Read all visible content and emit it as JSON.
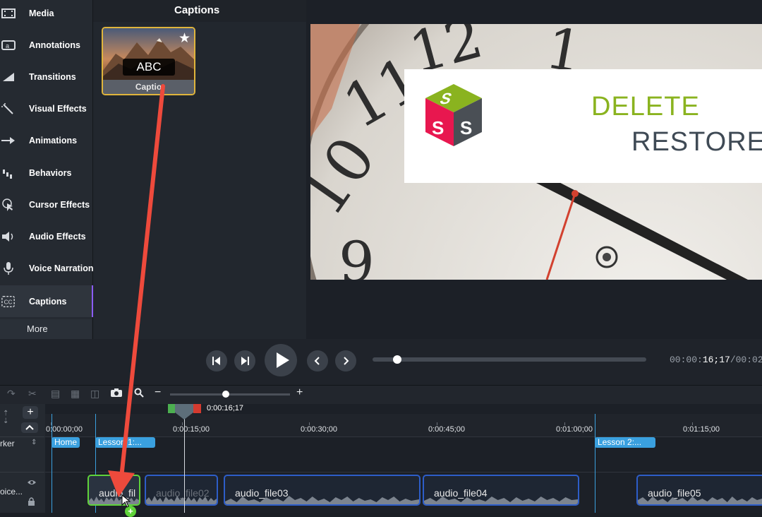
{
  "sidebar": {
    "items": [
      {
        "label": "Media",
        "icon": "film-icon"
      },
      {
        "label": "Annotations",
        "icon": "annotation-icon"
      },
      {
        "label": "Transitions",
        "icon": "transition-icon"
      },
      {
        "label": "Visual Effects",
        "icon": "magic-wand-icon"
      },
      {
        "label": "Animations",
        "icon": "arrow-animation-icon"
      },
      {
        "label": "Behaviors",
        "icon": "behaviors-icon"
      },
      {
        "label": "Cursor Effects",
        "icon": "cursor-icon"
      },
      {
        "label": "Audio Effects",
        "icon": "speaker-icon"
      },
      {
        "label": "Voice Narration",
        "icon": "microphone-icon"
      },
      {
        "label": "Captions",
        "icon": "cc-icon",
        "active": true
      }
    ],
    "more_label": "More"
  },
  "captions_panel": {
    "title": "Captions",
    "asset": {
      "label": "Captio",
      "overlay_text": "ABC"
    }
  },
  "preview": {
    "logo_text_1": "DELETE",
    "logo_text_2": "RESTORE"
  },
  "playback": {
    "timecode_dim": "00:00:",
    "timecode_bright": "16;17",
    "timecode_tail": "/00:02",
    "progress": 0.09
  },
  "timeline": {
    "playhead_time": "0:00:16;17",
    "ruler_labels": [
      "0:00:00;00",
      "0:00:15;00",
      "0:00:30;00",
      "0:00:45;00",
      "0:01:00;00",
      "0:01:15;00"
    ],
    "track_label_marker": "rker",
    "track_label_voice": "oice...",
    "markers": [
      "Home",
      "Lesson 1:...",
      "Lesson 2:..."
    ],
    "clips": [
      "audio_fil",
      "audio_file02",
      "audio_file03",
      "audio_file04",
      "audio_file05"
    ]
  },
  "colors": {
    "accent_purple": "#8b5cf6",
    "selection_gold": "#e0b53c",
    "marker_blue": "#3aa0df",
    "clip_blue": "#2d5dc8",
    "selected_clip_green": "#5fd33a",
    "annotation_red": "#ee4a3c"
  }
}
